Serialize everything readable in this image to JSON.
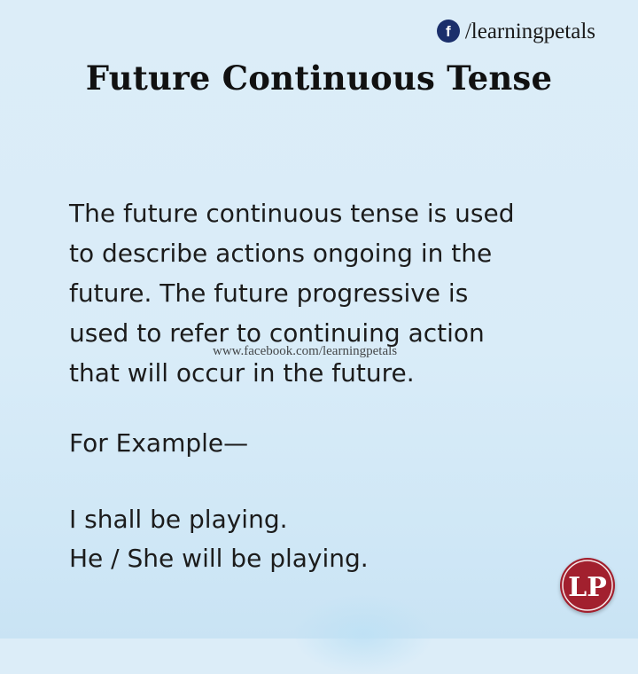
{
  "header": {
    "icon": "facebook-icon",
    "icon_glyph": "f",
    "handle": "/learningpetals"
  },
  "title": "Future Continuous Tense",
  "definition_lines": [
    "The future continuous tense is used",
    "to describe actions ongoing in the",
    "future. The future progressive is",
    "used to refer to continuing action",
    "that will occur in the future."
  ],
  "watermark": "www.facebook.com/learningpetals",
  "example_label": "For Example—",
  "examples": [
    "I shall be playing.",
    "He / She will be playing."
  ],
  "logo": {
    "text": "LP",
    "color": "#a2202e"
  },
  "colors": {
    "background": "#dcedf8",
    "text": "#1c1c1c",
    "facebook_icon": "#1b2f6b"
  }
}
